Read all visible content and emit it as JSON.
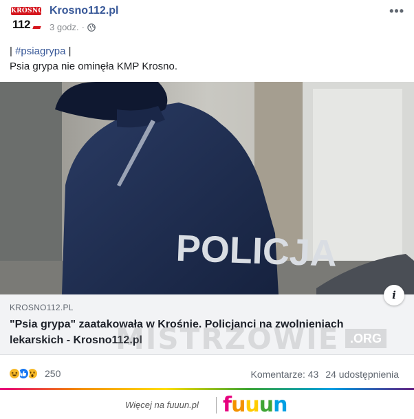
{
  "post": {
    "page_name": "Krosno112.pl",
    "time": "3 godz.",
    "time_separator": "·",
    "privacy_icon": "globe-icon",
    "more_label": "•••",
    "avatar": {
      "top_text": "KROSNO",
      "number_text": "112"
    },
    "text": {
      "pipe_open": "|",
      "hashtag": "#psiagrypa",
      "pipe_close": "|",
      "line2": "Psia grypa nie ominęła KMP Krosno."
    },
    "image": {
      "jacket_text": "POLICJA"
    }
  },
  "link_card": {
    "domain": "KROSNO112.PL",
    "title": "\"Psia grypa\" zaatakowała w Krośnie. Policjanci na zwolnieniach lekarskich - Krosno112.pl",
    "info_label": "i"
  },
  "watermark": {
    "text": "MISTRZOWIE",
    "suffix": ".ORG"
  },
  "footer": {
    "reactions": [
      "haha",
      "like",
      "wow"
    ],
    "reaction_count": "250",
    "comments": "Komentarze: 43",
    "shares": "24 udostępnienia"
  },
  "fuuun": {
    "more_text": "Więcej na fuuun.pl",
    "logo_letters": [
      "f",
      "u",
      "u",
      "u",
      "n"
    ],
    "logo_colors": [
      "#e6007e",
      "#f39200",
      "#ffcc00",
      "#3fa535",
      "#009fe3"
    ]
  },
  "colors": {
    "link_blue": "#385898",
    "card_bg": "#f2f3f5",
    "jacket_navy": "#1e2d4f",
    "reflective_text": "#d9dde3"
  }
}
